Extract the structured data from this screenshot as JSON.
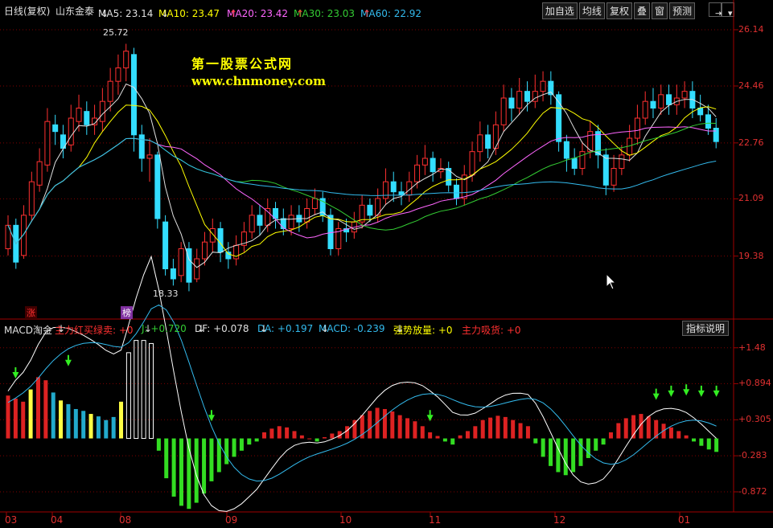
{
  "header": {
    "period": "日线(复权)",
    "stock_name": "山东金泰",
    "ma_labels": [
      {
        "text": "MA5: 23.14",
        "color": "#e0e0e0",
        "arrow": "↓"
      },
      {
        "text": "MA10: 23.47",
        "color": "#ffff00",
        "arrow": "↓"
      },
      {
        "text": "MA20: 23.42",
        "color": "#ff66ff",
        "arrow": "↑"
      },
      {
        "text": "MA30: 23.03",
        "color": "#33cc33",
        "arrow": "↑"
      },
      {
        "text": "MA60: 22.92",
        "color": "#33bbee",
        "arrow": "↑"
      }
    ],
    "buttons": [
      "加自选",
      "均线",
      "复权",
      "叠",
      "窗",
      "预测"
    ],
    "icon_names": [
      "jump-to-end-icon",
      "dropdown-icon"
    ],
    "icon_glyphs": [
      "⇥",
      "▾"
    ]
  },
  "watermark": {
    "line1": "第一股票公式网",
    "line2": "www.chnmoney.com"
  },
  "price_axis": {
    "ticks": [
      "26.14",
      "24.46",
      "22.76",
      "21.09",
      "19.38"
    ]
  },
  "annotations": {
    "high": "25.72",
    "low": "18.33",
    "badge1": "涨",
    "badge2": "榜"
  },
  "indicator": {
    "labels": [
      {
        "text": "MACD淘金",
        "color": "#e0e0e0"
      },
      {
        "text": "主力红买绿卖: +0",
        "color": "#ff3030",
        "arrow": "↓"
      },
      {
        "text": "J: +0.720",
        "color": "#33cc33",
        "arrow": "↓"
      },
      {
        "text": "DF: +0.078",
        "color": "#e0e0e0",
        "arrow": "↓"
      },
      {
        "text": "DA: +0.197",
        "color": "#33bbee",
        "arrow": "↓"
      },
      {
        "text": "MACD: -0.239",
        "color": "#33bbee",
        "arrow": "↓"
      },
      {
        "text": "强势放量: +0",
        "color": "#ffff00",
        "arrow": "↓"
      },
      {
        "text": "主力吸货: +0",
        "color": "#ff3030"
      }
    ],
    "explain_button": "指标说明",
    "ticks": [
      "+1.48",
      "+0.894",
      "+0.305",
      "-0.283",
      "-0.872"
    ]
  },
  "x_axis": {
    "labels": [
      "03",
      "04",
      "08",
      "09",
      "10",
      "11",
      "12",
      "01"
    ]
  },
  "colors": {
    "up": "#ff3030",
    "down": "#33ddff",
    "ma5": "#e0e0e0",
    "ma10": "#ffff00",
    "ma20": "#ff66ff",
    "ma30": "#33cc33",
    "ma60": "#33bbee",
    "grid": "#800000",
    "axis_text": "#e03030",
    "border": "#a00000"
  },
  "chart_data": [
    {
      "type": "candlestick",
      "title": "山东金泰 日线(复权)",
      "ylim": [
        17.5,
        26.5
      ],
      "ticks": [
        26.14,
        24.46,
        22.76,
        21.09,
        19.38
      ],
      "candles": [
        [
          19.6,
          20.3,
          19.4,
          20.6
        ],
        [
          20.3,
          19.2,
          19.0,
          20.5
        ],
        [
          19.4,
          20.6,
          19.3,
          20.9
        ],
        [
          20.6,
          21.6,
          20.4,
          21.9
        ],
        [
          21.5,
          22.2,
          21.3,
          22.6
        ],
        [
          22.1,
          23.4,
          21.9,
          23.8
        ],
        [
          23.3,
          23.1,
          22.7,
          23.6
        ],
        [
          23.0,
          22.6,
          22.3,
          23.3
        ],
        [
          22.7,
          23.5,
          22.5,
          23.9
        ],
        [
          23.4,
          23.8,
          23.1,
          24.2
        ],
        [
          23.7,
          23.3,
          23.0,
          24.0
        ],
        [
          23.3,
          23.5,
          23.0,
          23.9
        ],
        [
          23.4,
          24.0,
          23.1,
          24.4
        ],
        [
          24.0,
          24.6,
          23.7,
          25.0
        ],
        [
          24.6,
          25.0,
          24.2,
          25.4
        ],
        [
          25.0,
          25.5,
          24.6,
          25.72
        ],
        [
          25.4,
          23.0,
          22.5,
          25.6
        ],
        [
          23.0,
          22.3,
          21.9,
          23.3
        ],
        [
          22.3,
          22.4,
          21.6,
          22.9
        ],
        [
          22.4,
          20.5,
          20.2,
          22.5
        ],
        [
          20.4,
          19.0,
          18.8,
          20.6
        ],
        [
          19.0,
          18.7,
          18.5,
          19.3
        ],
        [
          18.8,
          19.6,
          18.6,
          19.8
        ],
        [
          19.6,
          18.6,
          18.33,
          19.8
        ],
        [
          18.7,
          19.3,
          18.6,
          19.6
        ],
        [
          19.3,
          19.8,
          19.1,
          20.1
        ],
        [
          19.8,
          20.2,
          19.5,
          20.5
        ],
        [
          20.2,
          19.5,
          19.2,
          20.4
        ],
        [
          19.5,
          19.3,
          19.0,
          19.8
        ],
        [
          19.3,
          19.7,
          19.1,
          20.0
        ],
        [
          19.7,
          20.1,
          19.5,
          20.4
        ],
        [
          20.1,
          20.6,
          19.9,
          20.9
        ],
        [
          20.6,
          20.3,
          20.0,
          20.9
        ],
        [
          20.3,
          20.8,
          20.1,
          21.1
        ],
        [
          20.8,
          20.5,
          20.2,
          21.0
        ],
        [
          20.5,
          20.2,
          20.0,
          20.8
        ],
        [
          20.2,
          20.6,
          20.0,
          20.9
        ],
        [
          20.6,
          20.4,
          20.1,
          20.9
        ],
        [
          20.4,
          20.8,
          20.2,
          21.1
        ],
        [
          20.8,
          21.1,
          20.6,
          21.4
        ],
        [
          21.1,
          20.6,
          20.4,
          21.3
        ],
        [
          20.6,
          19.6,
          19.4,
          20.8
        ],
        [
          19.6,
          20.2,
          19.4,
          20.4
        ],
        [
          20.2,
          20.1,
          19.8,
          20.5
        ],
        [
          20.1,
          20.4,
          19.9,
          20.7
        ],
        [
          20.4,
          20.9,
          20.2,
          21.2
        ],
        [
          20.9,
          20.6,
          20.4,
          21.1
        ],
        [
          20.6,
          21.1,
          20.4,
          21.4
        ],
        [
          21.1,
          21.6,
          20.9,
          22.0
        ],
        [
          21.6,
          21.3,
          21.0,
          21.9
        ],
        [
          21.3,
          21.2,
          20.9,
          21.6
        ],
        [
          21.2,
          21.6,
          21.0,
          21.9
        ],
        [
          21.6,
          22.1,
          21.4,
          22.4
        ],
        [
          22.1,
          22.3,
          21.8,
          22.7
        ],
        [
          22.3,
          21.9,
          21.6,
          22.5
        ],
        [
          21.9,
          22.0,
          21.7,
          22.3
        ],
        [
          22.0,
          21.5,
          21.3,
          22.2
        ],
        [
          21.5,
          21.1,
          20.9,
          21.7
        ],
        [
          21.1,
          21.8,
          20.9,
          22.1
        ],
        [
          21.8,
          22.5,
          21.6,
          22.8
        ],
        [
          22.5,
          23.0,
          22.2,
          23.4
        ],
        [
          23.0,
          22.6,
          22.3,
          23.3
        ],
        [
          22.6,
          23.3,
          22.4,
          23.7
        ],
        [
          23.3,
          24.1,
          23.1,
          24.5
        ],
        [
          24.1,
          23.8,
          23.4,
          24.4
        ],
        [
          23.8,
          24.3,
          23.6,
          24.7
        ],
        [
          24.3,
          24.0,
          23.7,
          24.6
        ],
        [
          24.0,
          24.3,
          23.8,
          24.8
        ],
        [
          24.3,
          24.6,
          24.0,
          24.9
        ],
        [
          24.6,
          24.2,
          23.9,
          24.9
        ],
        [
          24.2,
          22.8,
          22.5,
          24.3
        ],
        [
          22.8,
          22.3,
          21.9,
          23.0
        ],
        [
          22.3,
          22.0,
          21.8,
          22.6
        ],
        [
          22.0,
          22.5,
          21.8,
          22.8
        ],
        [
          22.5,
          23.1,
          22.3,
          23.4
        ],
        [
          23.1,
          22.4,
          22.0,
          23.3
        ],
        [
          22.4,
          21.5,
          21.2,
          22.6
        ],
        [
          21.5,
          22.0,
          21.3,
          22.4
        ],
        [
          22.0,
          22.4,
          21.8,
          22.7
        ],
        [
          22.4,
          22.9,
          22.2,
          23.3
        ],
        [
          22.9,
          23.5,
          22.7,
          23.9
        ],
        [
          23.5,
          24.0,
          23.3,
          24.3
        ],
        [
          24.0,
          23.8,
          23.5,
          24.4
        ],
        [
          23.8,
          24.2,
          23.6,
          24.5
        ],
        [
          24.2,
          23.9,
          23.6,
          24.5
        ],
        [
          23.9,
          24.1,
          23.6,
          24.5
        ],
        [
          24.1,
          24.3,
          23.8,
          24.6
        ],
        [
          24.3,
          23.8,
          23.5,
          24.6
        ],
        [
          23.8,
          23.6,
          23.4,
          24.2
        ],
        [
          23.6,
          23.2,
          23.0,
          23.9
        ],
        [
          23.2,
          22.8,
          22.6,
          23.5
        ]
      ]
    },
    {
      "type": "bar",
      "title": "MACD淘金",
      "ylim": [
        -1.2,
        1.7
      ],
      "ticks": [
        1.48,
        0.894,
        0.305,
        -0.283,
        -0.872
      ],
      "values": [
        0.7,
        0.65,
        0.6,
        0.8,
        1.0,
        0.95,
        0.75,
        0.62,
        0.56,
        0.48,
        0.45,
        0.4,
        0.36,
        0.3,
        0.35,
        0.6,
        1.4,
        1.6,
        1.6,
        1.55,
        -0.2,
        -0.65,
        -0.95,
        -1.1,
        -1.15,
        -1.05,
        -0.9,
        -0.7,
        -0.55,
        -0.42,
        -0.3,
        -0.2,
        -0.1,
        -0.05,
        0.1,
        0.16,
        0.2,
        0.18,
        0.12,
        0.05,
        0.0,
        -0.05,
        0.02,
        0.08,
        0.12,
        0.2,
        0.3,
        0.38,
        0.45,
        0.5,
        0.48,
        0.44,
        0.38,
        0.33,
        0.28,
        0.2,
        0.1,
        0.04,
        -0.05,
        -0.1,
        0.05,
        0.12,
        0.2,
        0.3,
        0.34,
        0.37,
        0.35,
        0.3,
        0.25,
        0.2,
        -0.08,
        -0.3,
        -0.45,
        -0.55,
        -0.6,
        -0.55,
        -0.45,
        -0.32,
        -0.2,
        -0.1,
        0.1,
        0.25,
        0.33,
        0.38,
        0.4,
        0.36,
        0.3,
        0.24,
        0.18,
        0.12,
        0.05,
        -0.05,
        -0.12,
        -0.18,
        -0.22
      ]
    }
  ]
}
